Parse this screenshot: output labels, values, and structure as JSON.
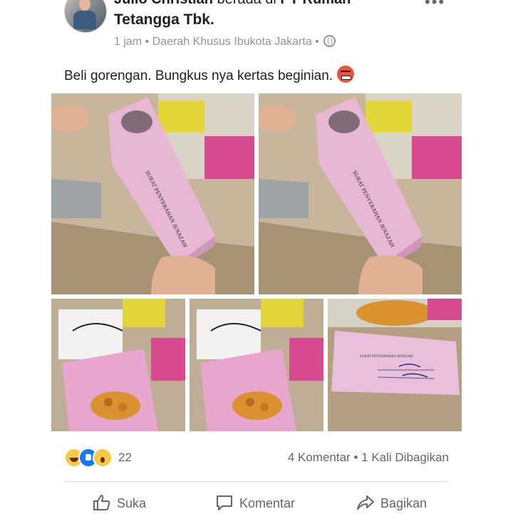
{
  "post": {
    "author_first": "Julio Christian",
    "author_mid": " berada di ",
    "place_line1": "PT Rumah",
    "place_line2": "Tetangga Tbk.",
    "time": "1 jam",
    "location": "Daerah Khusus Ibukota Jakarta",
    "sep": "•",
    "text": "Beli gorengan. Bungkus nya kertas beginian.",
    "more_icon": "more-dots-icon",
    "privacy_icon": "globe-icon",
    "emoji": "angry-emoji"
  },
  "photos": {
    "document_title": "SURAT PENYERAHAN JENAZAH"
  },
  "footer": {
    "reaction_count": "22",
    "comments": "4 Komentar",
    "shares": "1 Kali Dibagikan",
    "dot": "•",
    "like_label": "Suka",
    "comment_label": "Komentar",
    "share_label": "Bagikan"
  },
  "colors": {
    "text": "#1c1e21",
    "meta": "#90949c",
    "action": "#606770",
    "like_blue": "#1877f2",
    "paper_pink": "#e7b7d3"
  }
}
